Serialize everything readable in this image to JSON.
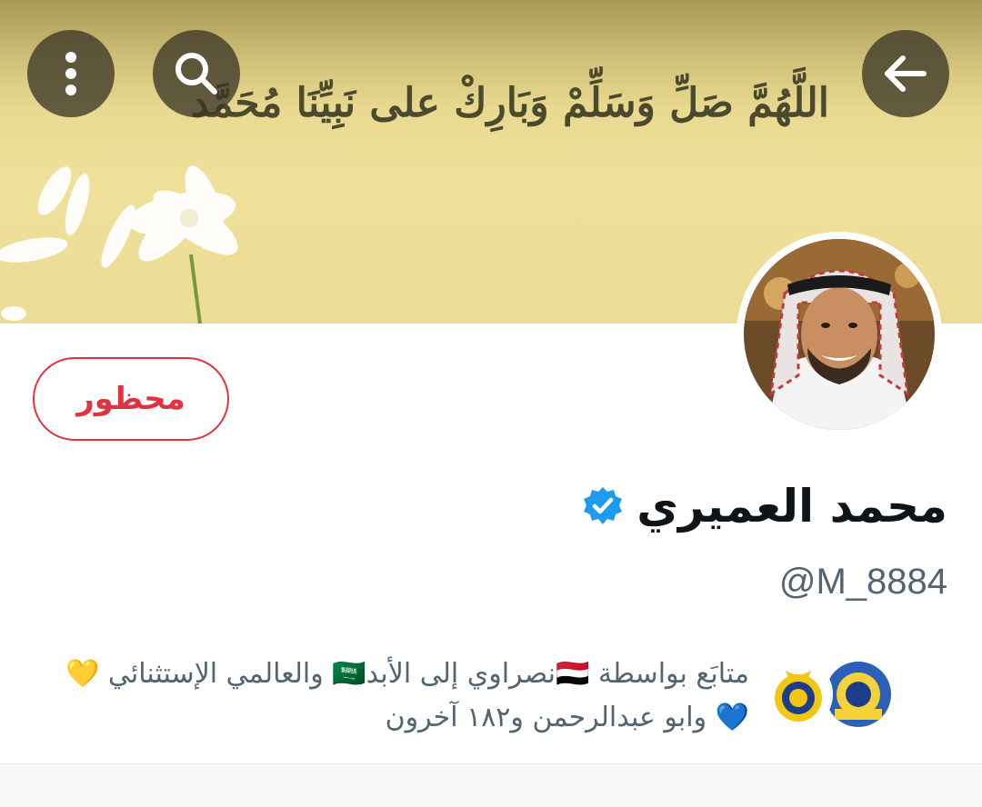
{
  "banner": {
    "text": "اللَّهُمَّ صَلِّ وَسَلِّمْ وَبَارِكْ على نَبِيِّنَا مُحَمَّد"
  },
  "header": {
    "more_icon": "more-vertical-icon",
    "search_icon": "search-icon",
    "back_icon": "arrow-left-icon"
  },
  "profile": {
    "blocked_label": "محظور",
    "name": "محمد العميري",
    "verified_icon": "verified-badge-icon",
    "handle": "@M_8884"
  },
  "followed_by": {
    "line1": "متابَع بواسطة 🇾🇪نصراوي إلى الأبد🇸🇦 والعالمي الإستثنائي 💛",
    "line2": "💙 وابو عبدالرحمن و١٨٢ آخرون"
  },
  "colors": {
    "accent_red": "#e0323f",
    "verified_blue": "#1d9bf0",
    "secondary_text": "#536471"
  }
}
